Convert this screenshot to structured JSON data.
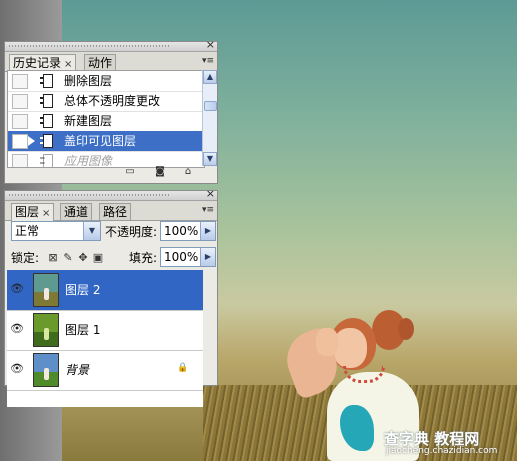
{
  "history_panel": {
    "tabs": [
      {
        "label": "历史记录",
        "close": "×"
      },
      {
        "label": "动作"
      }
    ],
    "close_glyph": "×",
    "menu_glyph": "▾≡",
    "items": [
      {
        "label": "删除图层",
        "selected": false,
        "faded": false
      },
      {
        "label": "总体不透明度更改",
        "selected": false,
        "faded": false
      },
      {
        "label": "新建图层",
        "selected": false,
        "faded": false
      },
      {
        "label": "盖印可见图层",
        "selected": true,
        "faded": false
      },
      {
        "label": "应用图像",
        "selected": false,
        "faded": true
      }
    ],
    "footer_icons": [
      "snapshot-doc-icon",
      "camera-icon",
      "trash-icon"
    ]
  },
  "layers_panel": {
    "tabs": [
      {
        "label": "图层",
        "close": "×"
      },
      {
        "label": "通道"
      },
      {
        "label": "路径"
      }
    ],
    "close_glyph": "×",
    "menu_glyph": "▾≡",
    "blend_mode": "正常",
    "opacity_label": "不透明度:",
    "opacity_value": "100%",
    "lock_label": "锁定:",
    "fill_label": "填充:",
    "fill_value": "100%",
    "layers": [
      {
        "name": "图层 2",
        "visible": true,
        "selected": true,
        "locked": false
      },
      {
        "name": "图层 1",
        "visible": true,
        "selected": false,
        "locked": false
      },
      {
        "name": "背景",
        "visible": true,
        "selected": false,
        "locked": true
      }
    ]
  },
  "watermark": {
    "main": "查字典 教程网",
    "url": "jiaocheng.chazidian.com"
  },
  "colors": {
    "selection": "#3d6fc6",
    "panel": "#ebeae5",
    "sky": "#7fb09c",
    "grass": "#8a7a3e"
  }
}
